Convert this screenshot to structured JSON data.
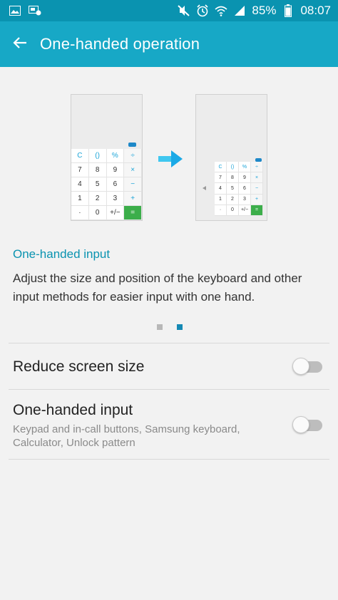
{
  "status_bar": {
    "battery": "85%",
    "time": "08:07",
    "icons": [
      "gallery-icon",
      "screen-cast-icon",
      "mute-icon",
      "alarm-icon",
      "wifi-icon",
      "signal-icon",
      "battery-icon"
    ]
  },
  "app_bar": {
    "title": "One-handed operation",
    "back_icon": "arrow-back-icon"
  },
  "illustration": {
    "keys": [
      "C",
      "()",
      "%",
      "÷",
      "7",
      "8",
      "9",
      "×",
      "4",
      "5",
      "6",
      "−",
      "1",
      "2",
      "3",
      "+",
      "·",
      "0",
      "+/−",
      "="
    ]
  },
  "tutorial": {
    "title": "One-handed input",
    "description": "Adjust the size and position of the keyboard and other input methods for easier input with one hand.",
    "page_count": 2,
    "active_page": 2
  },
  "settings": [
    {
      "title": "Reduce screen size",
      "subtitle": "",
      "enabled": false
    },
    {
      "title": "One-handed input",
      "subtitle": "Keypad and in-call buttons, Samsung keyboard, Calculator, Unlock pattern",
      "enabled": false
    }
  ],
  "colors": {
    "status_bar": "#0a93b0",
    "app_bar": "#17a8c6",
    "accent": "#0a93b0",
    "equals_key": "#3cae4a"
  }
}
